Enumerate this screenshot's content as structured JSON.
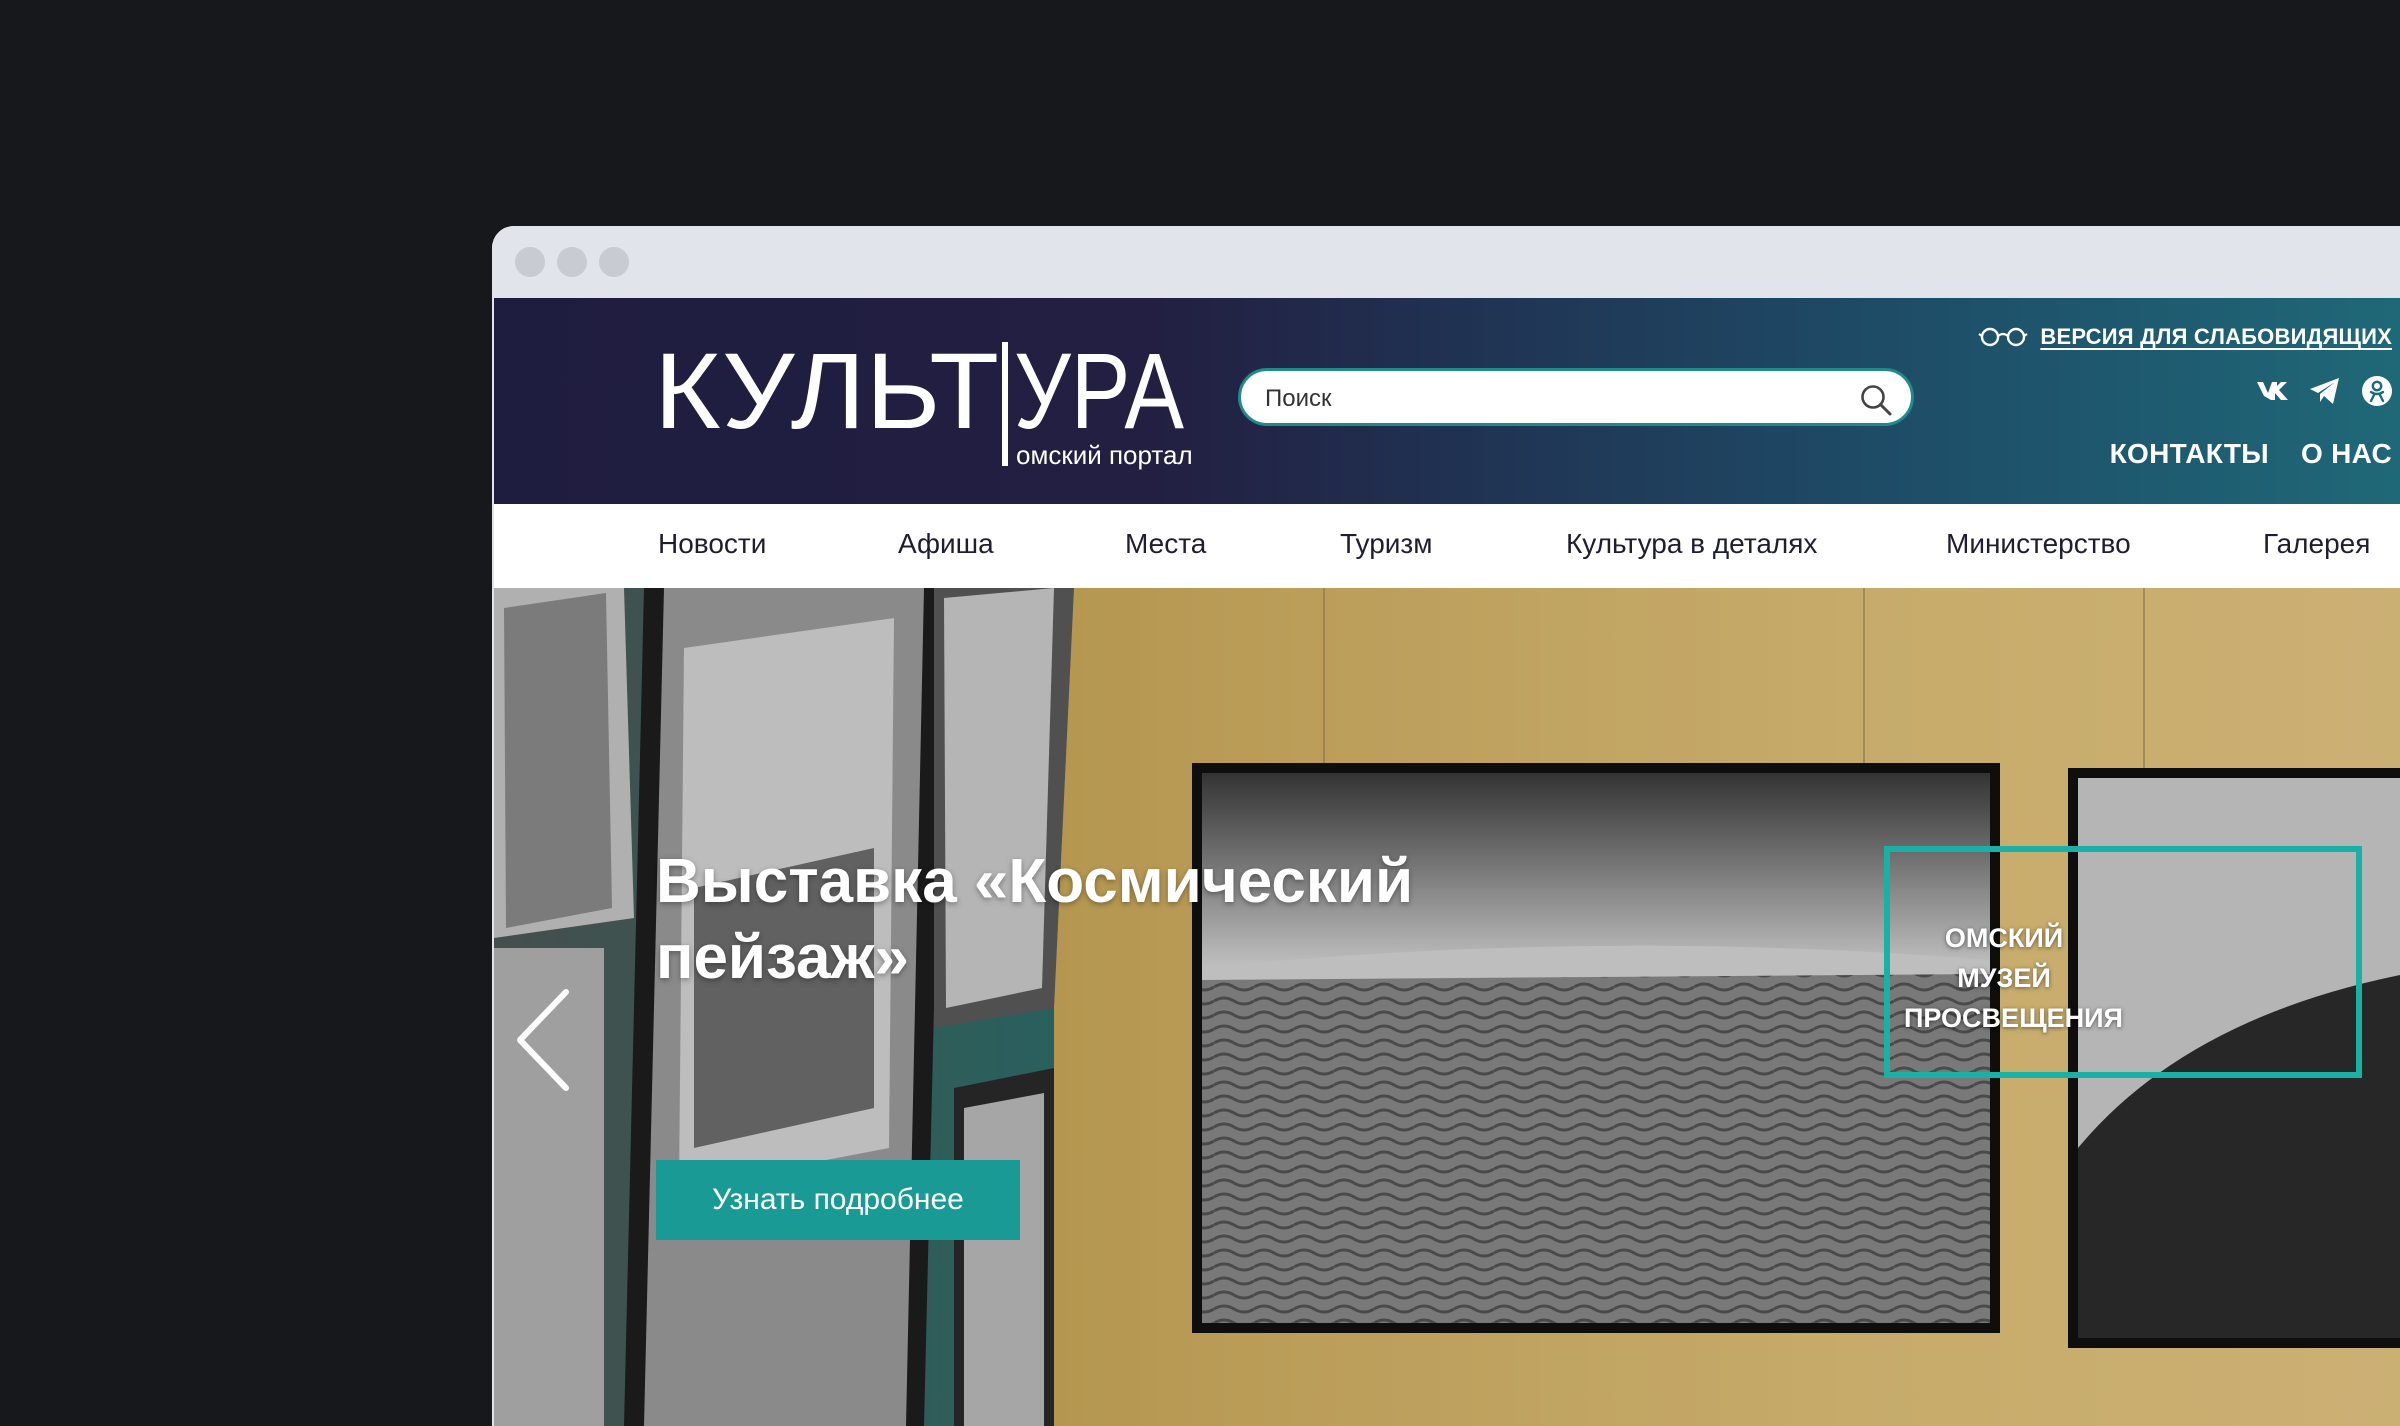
{
  "site": {
    "logo_text": "КУЛЬТ|УРА",
    "logo_subtitle": "омский портал"
  },
  "header": {
    "search_placeholder": "Поиск",
    "vision_label": "ВЕРСИЯ ДЛЯ СЛАБОВИДЯЩИХ",
    "socials": [
      "vk-icon",
      "telegram-icon",
      "odnoklassniki-icon"
    ],
    "links": [
      "КОНТАКТЫ",
      "О НАС"
    ]
  },
  "nav": {
    "items": [
      "Новости",
      "Афиша",
      "Места",
      "Туризм",
      "Культура в деталях",
      "Министерство",
      "Галерея"
    ]
  },
  "hero": {
    "title": "Выставка «Космический пейзаж»",
    "button_label": "Узнать подробнее",
    "museum_label": "ОМСКИЙ МУЗЕЙ ПРОСВЕЩЕНИЯ"
  },
  "colors": {
    "accent": "#1a9a94",
    "header_dark": "#1f1d3f",
    "header_teal": "#1f6a79"
  }
}
